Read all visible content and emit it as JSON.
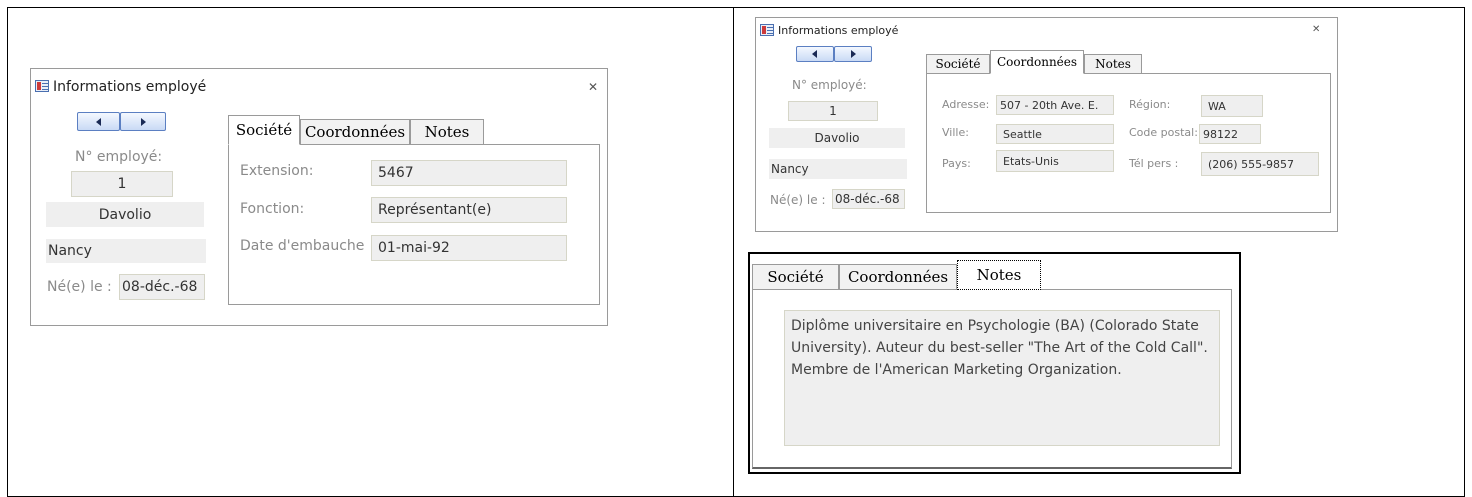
{
  "window": {
    "title": "Informations employé",
    "close": "✕"
  },
  "employee": {
    "id_label": "N° employé:",
    "id": "1",
    "last_name": "Davolio",
    "first_name": "Nancy",
    "birth_label": "Né(e) le :",
    "birth_date": "08-déc.-68"
  },
  "tabs": {
    "societe": "Société",
    "coordonnees": "Coordonnées",
    "notes": "Notes"
  },
  "societe": {
    "extension_label": "Extension:",
    "extension": "5467",
    "fonction_label": "Fonction:",
    "fonction": "Représentant(e)",
    "embauche_label": "Date d'embauche",
    "embauche": "01-mai-92"
  },
  "coordonnees": {
    "adresse_label": "Adresse:",
    "adresse": "507 - 20th Ave. E.",
    "region_label": "Région:",
    "region": "WA",
    "ville_label": "Ville:",
    "ville": "Seattle",
    "code_postal_label": "Code postal:",
    "code_postal": "98122",
    "pays_label": "Pays:",
    "pays": "Etats-Unis",
    "tel_label": "Tél pers :",
    "tel": "(206) 555-9857"
  },
  "notes": {
    "text": "Diplôme universitaire en Psychologie (BA) (Colorado State University). Auteur du best-seller \"The Art of the Cold Call\". Membre de l'American Marketing Organization."
  }
}
